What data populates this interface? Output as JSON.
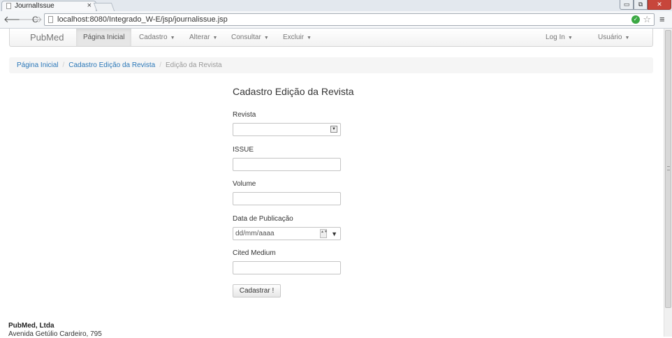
{
  "browser": {
    "tab_title": "JournalIssue",
    "tab_close": "×",
    "url": "localhost:8080/Integrado_W-E/jsp/journalissue.jsp",
    "window_buttons": {
      "minimize": "▭",
      "maximize": "⧉",
      "close": "✕"
    },
    "icons": {
      "back": "🡐",
      "forward": "🡒",
      "reload": "C",
      "menu": "≡",
      "ok": "✓",
      "star": "☆"
    }
  },
  "navbar": {
    "brand": "PubMed",
    "items": [
      {
        "label": "Página Inicial"
      },
      {
        "label": "Cadastro"
      },
      {
        "label": "Alterar"
      },
      {
        "label": "Consultar"
      },
      {
        "label": "Excluir"
      }
    ],
    "right_items": [
      {
        "label": "Log In"
      },
      {
        "label": "Usuário"
      }
    ],
    "caret": "▼"
  },
  "breadcrumb": {
    "items": [
      {
        "label": "Página Inicial"
      },
      {
        "label": "Cadastro Edição da Revista"
      },
      {
        "label": "Edição da Revista"
      }
    ],
    "separator": "/"
  },
  "form": {
    "title": "Cadastro Edição da Revista",
    "fields": [
      {
        "label": "Revista",
        "value": ""
      },
      {
        "label": "ISSUE",
        "value": ""
      },
      {
        "label": "Volume",
        "value": ""
      },
      {
        "label": "Data de Publicação",
        "placeholder": "dd/mm/aaaa"
      },
      {
        "label": "Cited Medium",
        "value": ""
      }
    ],
    "submit_label": "Cadastrar !",
    "select_arrow": "▼",
    "spin": "▲▼"
  },
  "footer": {
    "company": "PubMed, Ltda",
    "address": "Avenida Getúlio Cardeiro, 795"
  }
}
